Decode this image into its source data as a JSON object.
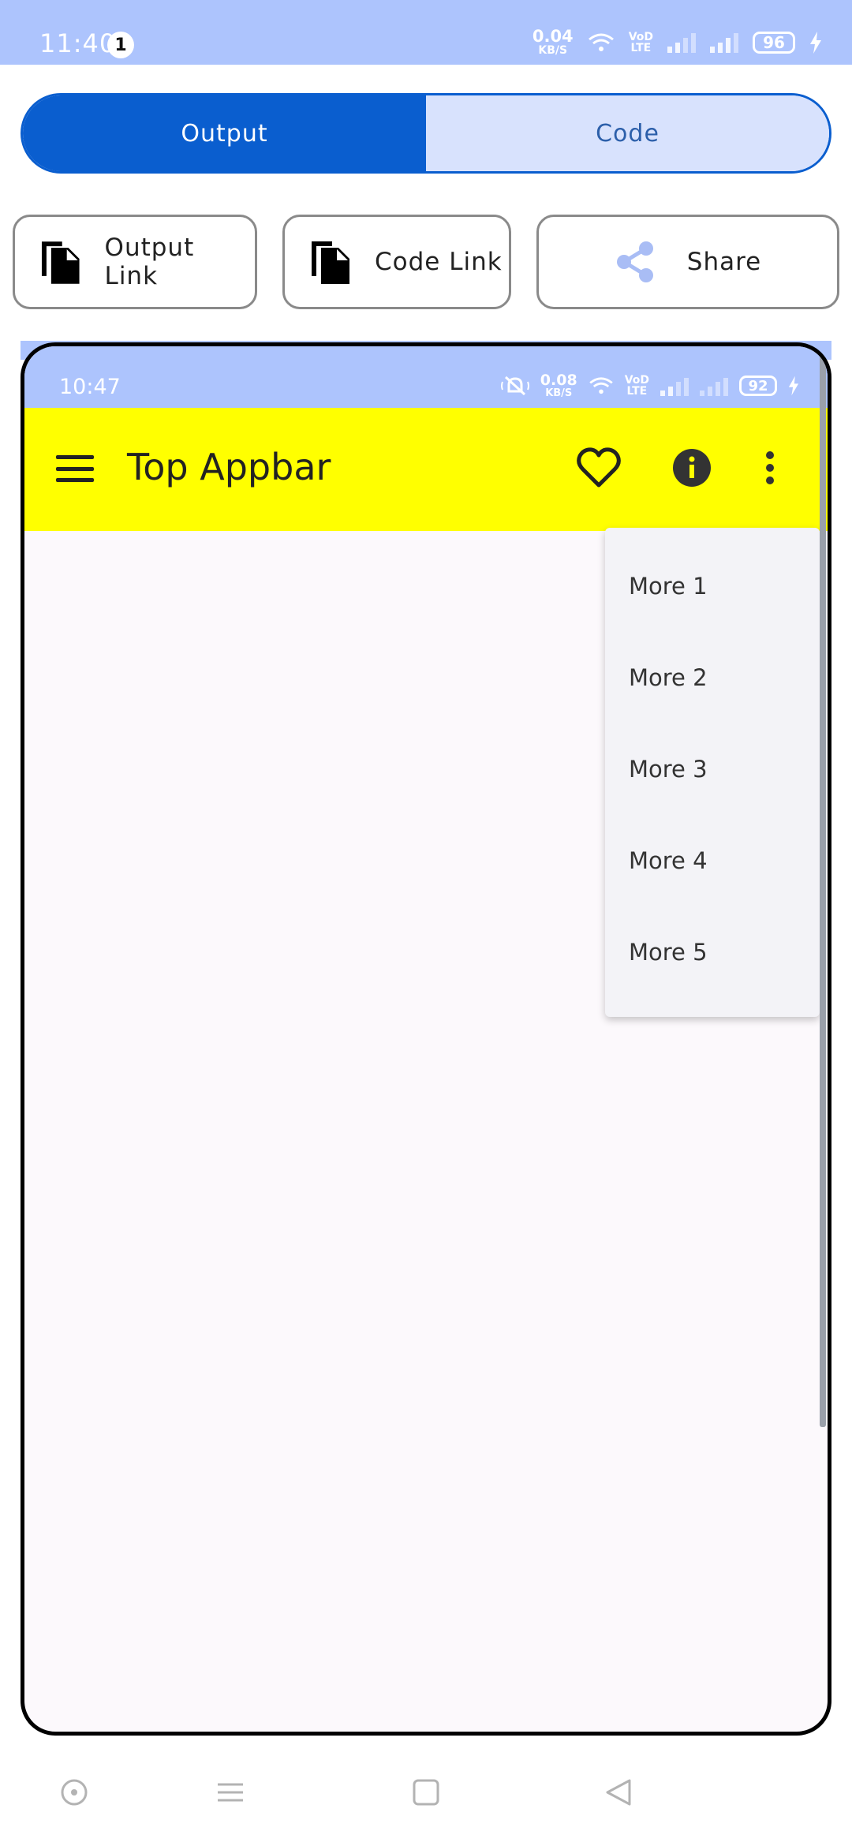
{
  "status_bar": {
    "time": "11:40",
    "notification_count": "1",
    "speed_value": "0.04",
    "speed_unit": "KB/S",
    "volte": "VoD\nLTE",
    "battery": "96"
  },
  "segmented": {
    "output_label": "Output",
    "code_label": "Code",
    "selected": "Output"
  },
  "actions": {
    "output_link_label": "Output Link",
    "code_link_label": "Code Link",
    "share_label": "Share"
  },
  "preview": {
    "status_bar": {
      "time": "10:47",
      "speed_value": "0.08",
      "speed_unit": "KB/S",
      "volte": "VoD\nLTE",
      "battery": "92"
    },
    "appbar": {
      "title": "Top Appbar",
      "background": "#ffff00"
    },
    "dropdown": {
      "items": [
        "More 1",
        "More 2",
        "More 3",
        "More 4",
        "More 5"
      ]
    }
  },
  "icons": [
    "menu-icon",
    "heart-icon",
    "info-icon",
    "more-vert-icon",
    "copy-icon",
    "share-icon"
  ],
  "colors": {
    "status_bar": "#adc4fd",
    "accent": "#0a5ecf",
    "segment_inactive": "#d8e2fd"
  }
}
